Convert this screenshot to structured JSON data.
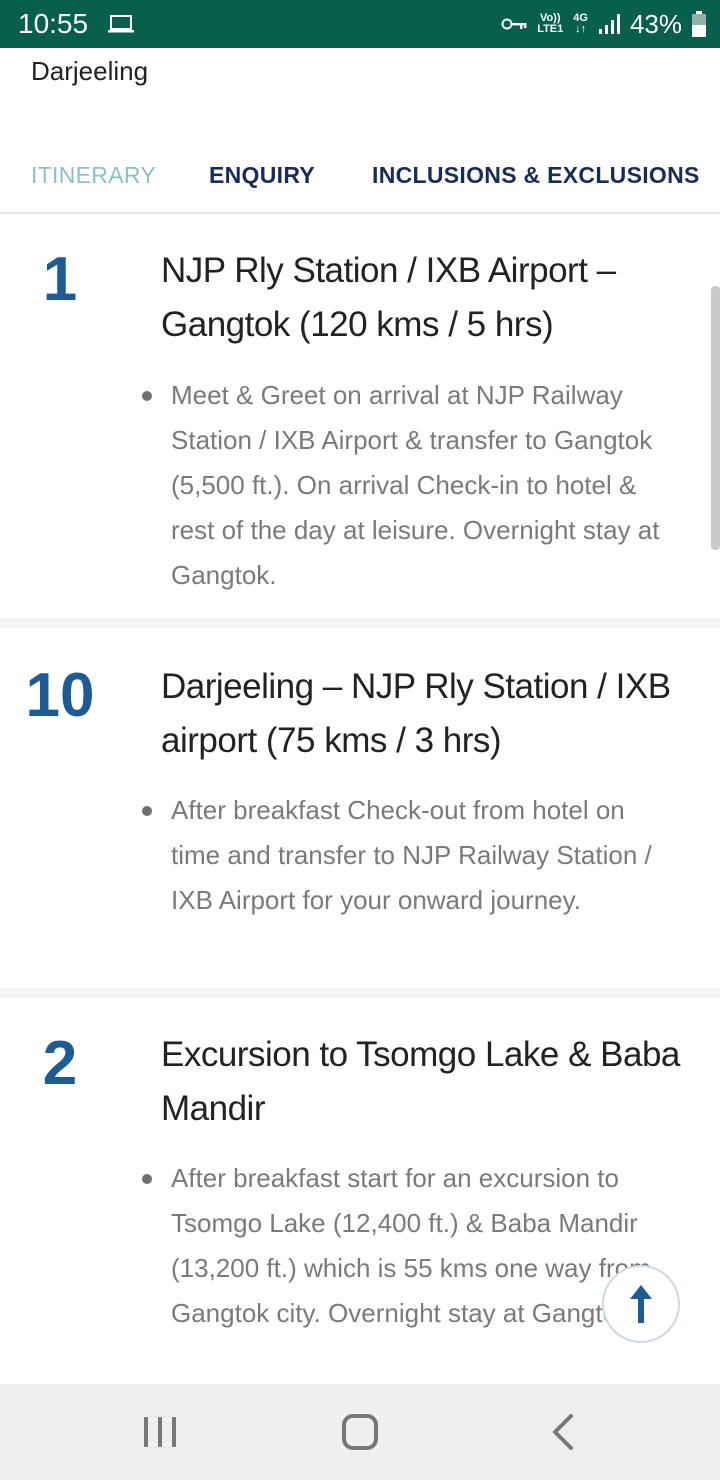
{
  "status_bar": {
    "time": "10:55",
    "volte_line1": "Vo))",
    "volte_line2": "LTE1",
    "network": "4G",
    "battery": "43%",
    "icons": [
      "laptop-icon",
      "key-icon",
      "signal-icon",
      "battery-icon"
    ]
  },
  "header": {
    "title": "Darjeeling"
  },
  "tabs": [
    {
      "label": "ITINERARY",
      "active": true
    },
    {
      "label": "ENQUIRY",
      "active": false
    },
    {
      "label": "INCLUSIONS & EXCLUSIONS",
      "active": false
    }
  ],
  "days": [
    {
      "number": "1",
      "title": "NJP Rly Station / IXB Airport – Gangtok (120 kms / 5 hrs)",
      "description": "Meet & Greet on arrival at NJP Railway Station / IXB Airport & transfer to Gangtok (5,500 ft.). On arrival Check-in to hotel & rest of the day at leisure. Overnight stay at Gangtok."
    },
    {
      "number": "10",
      "title": "Darjeeling – NJP Rly Station / IXB airport (75 kms / 3 hrs)",
      "description": "After breakfast Check-out from hotel on time and transfer to NJP Railway Station / IXB Airport for your onward journey."
    },
    {
      "number": "2",
      "title": "Excursion to Tsomgo Lake & Baba Mandir",
      "description": "After breakfast start for an excursion to Tsomgo Lake (12,400 ft.) & Baba Mandir (13,200 ft.) which is 55 kms one way from Gangtok city. Overnight stay at Gangtok."
    }
  ],
  "colors": {
    "status_bar": "#075f4c",
    "tab_active": "#8ec2c0",
    "tab_inactive": "#1a2b57",
    "day_number": "#1e5a95",
    "description": "#7a7a7a"
  },
  "nav_bar": {
    "icons": [
      "recents-icon",
      "home-icon",
      "back-icon"
    ]
  }
}
